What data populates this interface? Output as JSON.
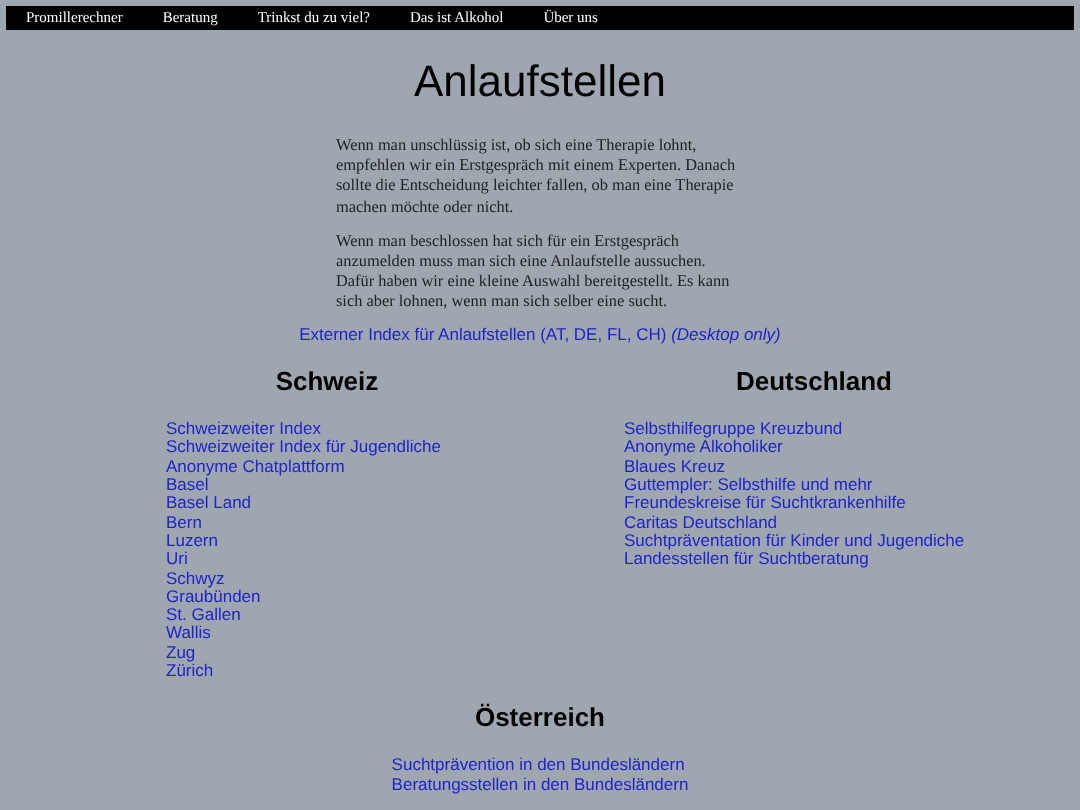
{
  "nav": [
    "Promillerechner",
    "Beratung",
    "Trinkst du zu viel?",
    "Das ist Alkohol",
    "Über uns"
  ],
  "title": "Anlaufstellen",
  "paragraphs": [
    "Wenn man unschlüssig ist, ob sich eine Therapie lohnt, empfehlen wir ein Erstgespräch mit einem Experten. Danach sollte die Entscheidung leichter fallen, ob man eine Therapie machen möchte oder nicht.",
    "Wenn man beschlossen hat sich für ein Erstgespräch anzumelden muss man sich eine Anlaufstelle aussuchen. Dafür haben wir eine kleine Auswahl bereitgestellt. Es kann sich aber lohnen, wenn man sich selber eine sucht."
  ],
  "external_link": {
    "text": "Externer Index für Anlaufstellen (AT, DE, FL, CH)",
    "note": "(Desktop only)"
  },
  "sections": [
    {
      "heading": "Schweiz",
      "links": [
        "Schweizweiter Index",
        "Schweizweiter Index für Jugendliche",
        "Anonyme Chatplattform",
        "Basel",
        "Basel Land",
        "Bern",
        "Luzern",
        "Uri",
        "Schwyz",
        "Graubünden",
        "St. Gallen",
        "Wallis",
        "Zug",
        "Zürich"
      ]
    },
    {
      "heading": "Deutschland",
      "links": [
        "Selbsthilfegruppe Kreuzbund",
        "Anonyme Alkoholiker",
        "Blaues Kreuz",
        "Guttempler: Selbsthilfe und mehr",
        "Freundeskreise für Suchtkrankenhilfe",
        "Caritas Deutschland",
        "Suchtpräventation für Kinder und Jugendiche",
        "Landesstellen für Suchtberatung"
      ]
    },
    {
      "heading": "Österreich",
      "links": [
        "Suchtprävention in den Bundesländern",
        "Beratungsstellen in den Bundesländern"
      ]
    }
  ]
}
